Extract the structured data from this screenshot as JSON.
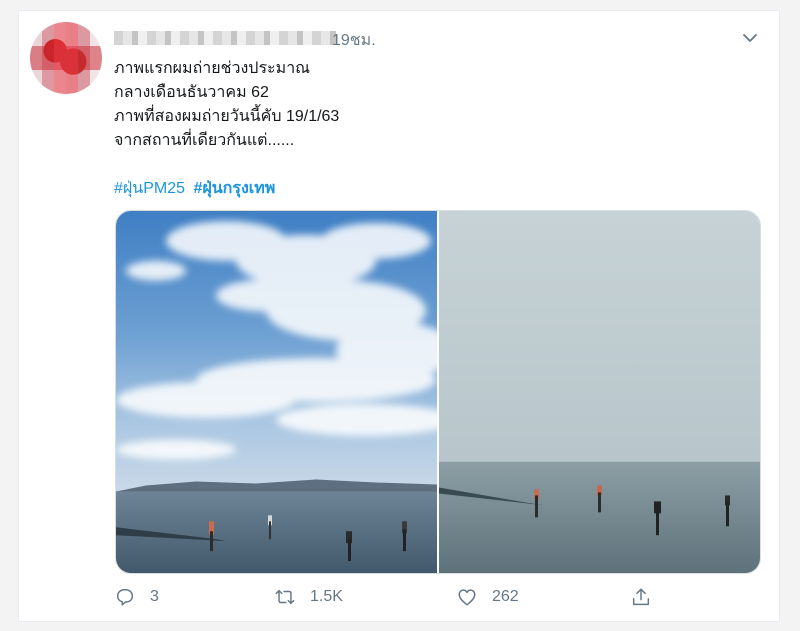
{
  "tweet": {
    "time": "19ชม.",
    "text_lines": [
      "ภาพแรกผมถ่ายช่วงประมาณ",
      "กลางเดือนธันวาคม 62",
      "ภาพที่สองผมถ่ายวันนี้คับ 19/1/63",
      "จากสถานที่เดียวกันแต่......"
    ],
    "hashtags": [
      "#ฝุ่นPM25",
      "#ฝุ่นกรุงเทพ"
    ],
    "actions": {
      "reply_count": "3",
      "retweet_count": "1.5K",
      "like_count": "262"
    }
  },
  "icons": {
    "menu": "chevron-down-icon",
    "reply": "reply-icon",
    "retweet": "retweet-icon",
    "like": "heart-icon",
    "share": "share-icon"
  },
  "colors": {
    "link": "#1b95e0",
    "muted": "#657786",
    "text": "#14171a"
  }
}
